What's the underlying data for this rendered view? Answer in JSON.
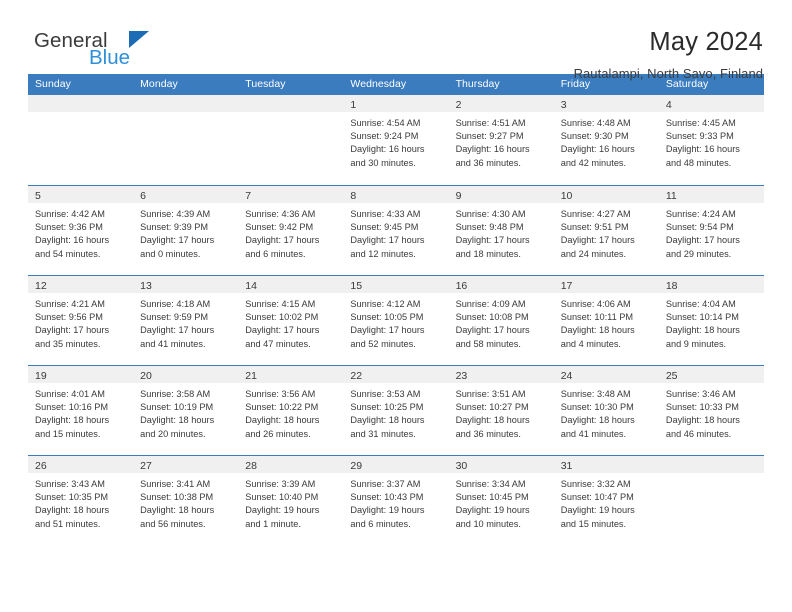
{
  "brand": {
    "name_part1": "General",
    "name_part2": "Blue",
    "triangle_color": "#1b6cb5",
    "blue_color": "#2f8fd8"
  },
  "header": {
    "title": "May 2024",
    "subtitle": "Rautalampi, North Savo, Finland"
  },
  "theme": {
    "header_bar_color": "#3b7cbf",
    "cell_head_color": "#f0f0f0",
    "text_color": "#3a3a3a"
  },
  "weekdays": [
    "Sunday",
    "Monday",
    "Tuesday",
    "Wednesday",
    "Thursday",
    "Friday",
    "Saturday"
  ],
  "labels": {
    "sunrise": "Sunrise:",
    "sunset": "Sunset:",
    "daylight": "Daylight:"
  },
  "weeks": [
    [
      {
        "day": ""
      },
      {
        "day": ""
      },
      {
        "day": ""
      },
      {
        "day": "1",
        "sunrise": "Sunrise: 4:54 AM",
        "sunset": "Sunset: 9:24 PM",
        "daylight1": "Daylight: 16 hours",
        "daylight2": "and 30 minutes."
      },
      {
        "day": "2",
        "sunrise": "Sunrise: 4:51 AM",
        "sunset": "Sunset: 9:27 PM",
        "daylight1": "Daylight: 16 hours",
        "daylight2": "and 36 minutes."
      },
      {
        "day": "3",
        "sunrise": "Sunrise: 4:48 AM",
        "sunset": "Sunset: 9:30 PM",
        "daylight1": "Daylight: 16 hours",
        "daylight2": "and 42 minutes."
      },
      {
        "day": "4",
        "sunrise": "Sunrise: 4:45 AM",
        "sunset": "Sunset: 9:33 PM",
        "daylight1": "Daylight: 16 hours",
        "daylight2": "and 48 minutes."
      }
    ],
    [
      {
        "day": "5",
        "sunrise": "Sunrise: 4:42 AM",
        "sunset": "Sunset: 9:36 PM",
        "daylight1": "Daylight: 16 hours",
        "daylight2": "and 54 minutes."
      },
      {
        "day": "6",
        "sunrise": "Sunrise: 4:39 AM",
        "sunset": "Sunset: 9:39 PM",
        "daylight1": "Daylight: 17 hours",
        "daylight2": "and 0 minutes."
      },
      {
        "day": "7",
        "sunrise": "Sunrise: 4:36 AM",
        "sunset": "Sunset: 9:42 PM",
        "daylight1": "Daylight: 17 hours",
        "daylight2": "and 6 minutes."
      },
      {
        "day": "8",
        "sunrise": "Sunrise: 4:33 AM",
        "sunset": "Sunset: 9:45 PM",
        "daylight1": "Daylight: 17 hours",
        "daylight2": "and 12 minutes."
      },
      {
        "day": "9",
        "sunrise": "Sunrise: 4:30 AM",
        "sunset": "Sunset: 9:48 PM",
        "daylight1": "Daylight: 17 hours",
        "daylight2": "and 18 minutes."
      },
      {
        "day": "10",
        "sunrise": "Sunrise: 4:27 AM",
        "sunset": "Sunset: 9:51 PM",
        "daylight1": "Daylight: 17 hours",
        "daylight2": "and 24 minutes."
      },
      {
        "day": "11",
        "sunrise": "Sunrise: 4:24 AM",
        "sunset": "Sunset: 9:54 PM",
        "daylight1": "Daylight: 17 hours",
        "daylight2": "and 29 minutes."
      }
    ],
    [
      {
        "day": "12",
        "sunrise": "Sunrise: 4:21 AM",
        "sunset": "Sunset: 9:56 PM",
        "daylight1": "Daylight: 17 hours",
        "daylight2": "and 35 minutes."
      },
      {
        "day": "13",
        "sunrise": "Sunrise: 4:18 AM",
        "sunset": "Sunset: 9:59 PM",
        "daylight1": "Daylight: 17 hours",
        "daylight2": "and 41 minutes."
      },
      {
        "day": "14",
        "sunrise": "Sunrise: 4:15 AM",
        "sunset": "Sunset: 10:02 PM",
        "daylight1": "Daylight: 17 hours",
        "daylight2": "and 47 minutes."
      },
      {
        "day": "15",
        "sunrise": "Sunrise: 4:12 AM",
        "sunset": "Sunset: 10:05 PM",
        "daylight1": "Daylight: 17 hours",
        "daylight2": "and 52 minutes."
      },
      {
        "day": "16",
        "sunrise": "Sunrise: 4:09 AM",
        "sunset": "Sunset: 10:08 PM",
        "daylight1": "Daylight: 17 hours",
        "daylight2": "and 58 minutes."
      },
      {
        "day": "17",
        "sunrise": "Sunrise: 4:06 AM",
        "sunset": "Sunset: 10:11 PM",
        "daylight1": "Daylight: 18 hours",
        "daylight2": "and 4 minutes."
      },
      {
        "day": "18",
        "sunrise": "Sunrise: 4:04 AM",
        "sunset": "Sunset: 10:14 PM",
        "daylight1": "Daylight: 18 hours",
        "daylight2": "and 9 minutes."
      }
    ],
    [
      {
        "day": "19",
        "sunrise": "Sunrise: 4:01 AM",
        "sunset": "Sunset: 10:16 PM",
        "daylight1": "Daylight: 18 hours",
        "daylight2": "and 15 minutes."
      },
      {
        "day": "20",
        "sunrise": "Sunrise: 3:58 AM",
        "sunset": "Sunset: 10:19 PM",
        "daylight1": "Daylight: 18 hours",
        "daylight2": "and 20 minutes."
      },
      {
        "day": "21",
        "sunrise": "Sunrise: 3:56 AM",
        "sunset": "Sunset: 10:22 PM",
        "daylight1": "Daylight: 18 hours",
        "daylight2": "and 26 minutes."
      },
      {
        "day": "22",
        "sunrise": "Sunrise: 3:53 AM",
        "sunset": "Sunset: 10:25 PM",
        "daylight1": "Daylight: 18 hours",
        "daylight2": "and 31 minutes."
      },
      {
        "day": "23",
        "sunrise": "Sunrise: 3:51 AM",
        "sunset": "Sunset: 10:27 PM",
        "daylight1": "Daylight: 18 hours",
        "daylight2": "and 36 minutes."
      },
      {
        "day": "24",
        "sunrise": "Sunrise: 3:48 AM",
        "sunset": "Sunset: 10:30 PM",
        "daylight1": "Daylight: 18 hours",
        "daylight2": "and 41 minutes."
      },
      {
        "day": "25",
        "sunrise": "Sunrise: 3:46 AM",
        "sunset": "Sunset: 10:33 PM",
        "daylight1": "Daylight: 18 hours",
        "daylight2": "and 46 minutes."
      }
    ],
    [
      {
        "day": "26",
        "sunrise": "Sunrise: 3:43 AM",
        "sunset": "Sunset: 10:35 PM",
        "daylight1": "Daylight: 18 hours",
        "daylight2": "and 51 minutes."
      },
      {
        "day": "27",
        "sunrise": "Sunrise: 3:41 AM",
        "sunset": "Sunset: 10:38 PM",
        "daylight1": "Daylight: 18 hours",
        "daylight2": "and 56 minutes."
      },
      {
        "day": "28",
        "sunrise": "Sunrise: 3:39 AM",
        "sunset": "Sunset: 10:40 PM",
        "daylight1": "Daylight: 19 hours",
        "daylight2": "and 1 minute."
      },
      {
        "day": "29",
        "sunrise": "Sunrise: 3:37 AM",
        "sunset": "Sunset: 10:43 PM",
        "daylight1": "Daylight: 19 hours",
        "daylight2": "and 6 minutes."
      },
      {
        "day": "30",
        "sunrise": "Sunrise: 3:34 AM",
        "sunset": "Sunset: 10:45 PM",
        "daylight1": "Daylight: 19 hours",
        "daylight2": "and 10 minutes."
      },
      {
        "day": "31",
        "sunrise": "Sunrise: 3:32 AM",
        "sunset": "Sunset: 10:47 PM",
        "daylight1": "Daylight: 19 hours",
        "daylight2": "and 15 minutes."
      },
      {
        "day": ""
      }
    ]
  ]
}
